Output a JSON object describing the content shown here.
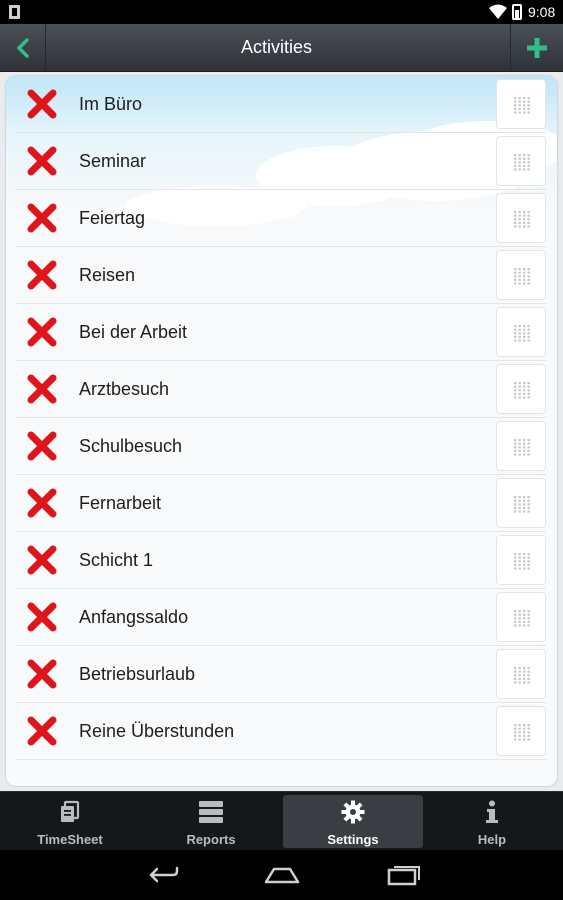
{
  "status_bar": {
    "time": "9:08"
  },
  "action_bar": {
    "title": "Activities",
    "back_icon": "chevron-left-icon",
    "add_icon": "plus-icon",
    "accent": "#2fbf8a"
  },
  "activities": [
    {
      "label": "Im Büro"
    },
    {
      "label": "Seminar"
    },
    {
      "label": "Feiertag"
    },
    {
      "label": "Reisen"
    },
    {
      "label": "Bei der Arbeit"
    },
    {
      "label": "Arztbesuch"
    },
    {
      "label": "Schulbesuch"
    },
    {
      "label": "Fernarbeit"
    },
    {
      "label": "Schicht 1"
    },
    {
      "label": "Anfangssaldo"
    },
    {
      "label": "Betriebsurlaub"
    },
    {
      "label": "Reine Überstunden"
    }
  ],
  "delete_color": "#e0151b",
  "tabs": [
    {
      "label": "TimeSheet",
      "icon": "timesheet-icon"
    },
    {
      "label": "Reports",
      "icon": "reports-icon"
    },
    {
      "label": "Settings",
      "icon": "gear-icon",
      "active": true
    },
    {
      "label": "Help",
      "icon": "info-icon"
    }
  ]
}
